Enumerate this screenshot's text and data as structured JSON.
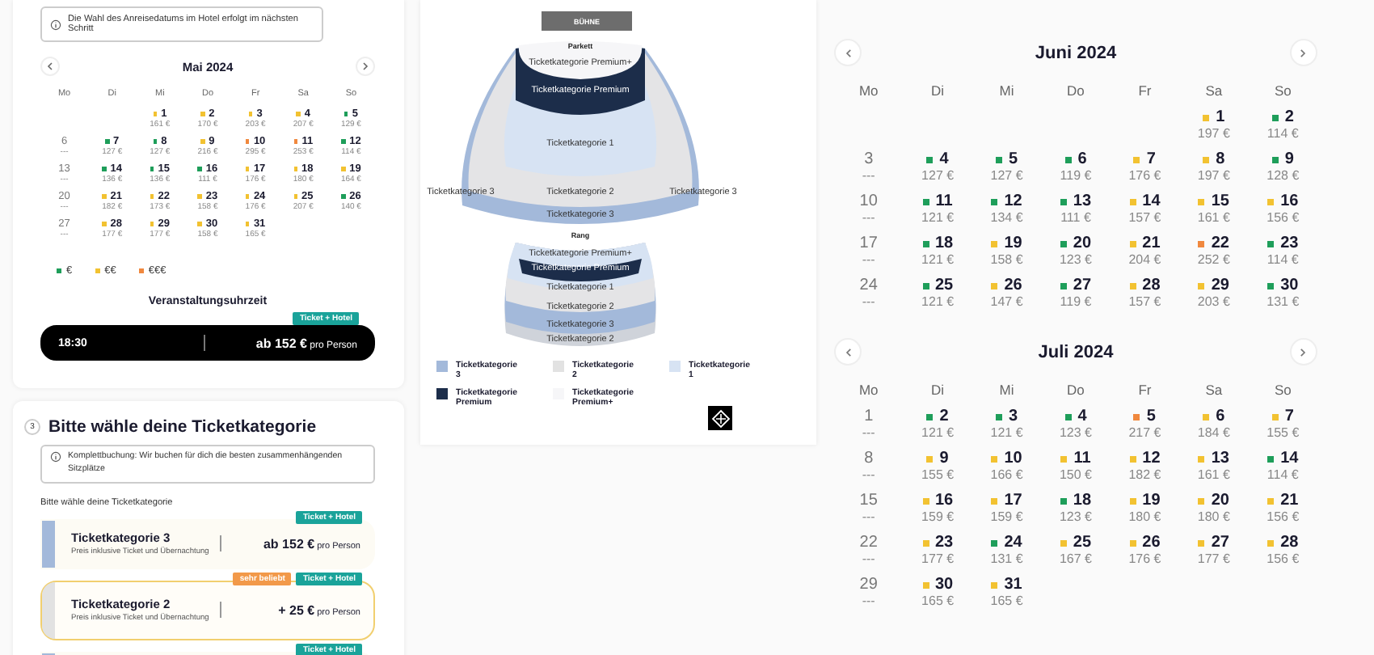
{
  "date_panel": {
    "notice": "Die Wahl des Anreisedatums im Hotel erfolgt im nächsten Schritt",
    "calendar": {
      "title": "Mai 2024",
      "weekdays": [
        "Mo",
        "Di",
        "Mi",
        "Do",
        "Fr",
        "Sa",
        "So"
      ],
      "weeks": [
        [
          {
            "day": "1",
            "price": "161 €",
            "color": "#f2c231"
          },
          {
            "day": "2",
            "price": "170 €",
            "color": "#f2c231"
          },
          {
            "day": "3",
            "price": "203 €",
            "color": "#f2c231"
          },
          {
            "day": "4",
            "price": "207 €",
            "color": "#f2c231"
          },
          {
            "day": "5",
            "price": "129 €",
            "color": "#1e9e5a"
          }
        ],
        [
          {
            "day": "6",
            "price": "---"
          },
          {
            "day": "7",
            "price": "127 €",
            "color": "#1e9e5a"
          },
          {
            "day": "8",
            "price": "127 €",
            "color": "#1e9e5a"
          },
          {
            "day": "9",
            "price": "216 €",
            "color": "#f2c231"
          },
          {
            "day": "10",
            "price": "295 €",
            "color": "#f0883e"
          },
          {
            "day": "11",
            "price": "253 €",
            "color": "#f0883e"
          },
          {
            "day": "12",
            "price": "114 €",
            "color": "#1e9e5a"
          }
        ],
        [
          {
            "day": "13",
            "price": "---"
          },
          {
            "day": "14",
            "price": "136 €",
            "color": "#1e9e5a"
          },
          {
            "day": "15",
            "price": "136 €",
            "color": "#1e9e5a"
          },
          {
            "day": "16",
            "price": "111 €",
            "color": "#1e9e5a"
          },
          {
            "day": "17",
            "price": "176 €",
            "color": "#f2c231"
          },
          {
            "day": "18",
            "price": "180 €",
            "color": "#f2c231"
          },
          {
            "day": "19",
            "price": "164 €",
            "color": "#f2c231"
          }
        ],
        [
          {
            "day": "20",
            "price": "---"
          },
          {
            "day": "21",
            "price": "182 €",
            "color": "#f2c231"
          },
          {
            "day": "22",
            "price": "173 €",
            "color": "#f2c231"
          },
          {
            "day": "23",
            "price": "158 €",
            "color": "#f2c231"
          },
          {
            "day": "24",
            "price": "176 €",
            "color": "#f2c231"
          },
          {
            "day": "25",
            "price": "207 €",
            "color": "#f2c231"
          },
          {
            "day": "26",
            "price": "140 €",
            "color": "#1e9e5a"
          }
        ],
        [
          {
            "day": "27",
            "price": "---"
          },
          {
            "day": "28",
            "price": "177 €",
            "color": "#f2c231"
          },
          {
            "day": "29",
            "price": "177 €",
            "color": "#f2c231"
          },
          {
            "day": "30",
            "price": "158 €",
            "color": "#f2c231"
          },
          {
            "day": "31",
            "price": "165 €",
            "color": "#f2c231"
          }
        ]
      ]
    },
    "legend": [
      {
        "label": "€",
        "color": "#1e9e5a"
      },
      {
        "label": "€€",
        "color": "#f2c231"
      },
      {
        "label": "€€€",
        "color": "#f0883e"
      }
    ],
    "time_heading": "Veranstaltungsuhrzeit",
    "time_slots": [
      {
        "time": "18:30",
        "price": "ab 152 €",
        "unit": "pro Person",
        "badge": "Ticket + Hotel",
        "selected": true
      }
    ]
  },
  "category_panel": {
    "step": "3",
    "heading": "Bitte wähle deine Ticketkategorie",
    "notice": "Komplettbuchung: Wir buchen für dich die besten zusammenhängenden Sitzplätze",
    "label": "Bitte wähle deine Ticketkategorie",
    "categories": [
      {
        "title": "Ticketkategorie 3",
        "description": "Preis inklusive Ticket und Übernachtung",
        "price": "ab 152 €",
        "unit": "pro Person",
        "badges": [
          {
            "kind": "hotel",
            "text": "Ticket + Hotel"
          }
        ],
        "color": "#a3b9da",
        "selected": false
      },
      {
        "title": "Ticketkategorie 2",
        "description": "Preis inklusive Ticket und Übernachtung",
        "price": "+ 25 €",
        "unit": "pro Person",
        "badges": [
          {
            "kind": "popular",
            "text": "sehr beliebt"
          },
          {
            "kind": "hotel",
            "text": "Ticket + Hotel"
          }
        ],
        "color": "#e2e2e2",
        "selected": true
      },
      {
        "badges": [
          {
            "kind": "hotel",
            "text": "Ticket + Hotel"
          }
        ],
        "color": "#a3b9da",
        "selected": false
      }
    ]
  },
  "seat_map": {
    "stage": "BÜHNE",
    "sections": [
      {
        "name": "Parkett",
        "zones": [
          "Ticketkategorie Premium+",
          "Ticketkategorie Premium",
          "Ticketkategorie 1",
          "Ticketkategorie 3",
          "Ticketkategorie 2",
          "Ticketkategorie 3",
          "Ticketkategorie 3"
        ]
      },
      {
        "name": "Rang",
        "zones": [
          "Ticketkategorie Premium+",
          "Ticketkategorie Premium",
          "Ticketkategorie 1",
          "Ticketkategorie 2",
          "Ticketkategorie 3",
          "Ticketkategorie 2"
        ]
      }
    ],
    "legend": [
      {
        "label": "Ticketkategorie 3",
        "color": "#a3b9da"
      },
      {
        "label": "Ticketkategorie 2",
        "color": "#e2e2e2"
      },
      {
        "label": "Ticketkategorie 1",
        "color": "#d7e3f3"
      },
      {
        "label": "Ticketkategorie Premium",
        "color": "#1c2d4a"
      },
      {
        "label": "Ticketkategorie Premium+",
        "color": "#f6f6f8"
      }
    ]
  },
  "calendars": [
    {
      "title": "Juni 2024",
      "weekdays": [
        "Mo",
        "Di",
        "Mi",
        "Do",
        "Fr",
        "Sa",
        "So"
      ],
      "weeks": [
        [
          {
            "day": "1",
            "price": "197 €",
            "color": "#f2c231"
          },
          {
            "day": "2",
            "price": "114 €",
            "color": "#1e9e5a"
          }
        ],
        [
          {
            "day": "3",
            "price": "---"
          },
          {
            "day": "4",
            "price": "127 €",
            "color": "#1e9e5a"
          },
          {
            "day": "5",
            "price": "127 €",
            "color": "#1e9e5a"
          },
          {
            "day": "6",
            "price": "119 €",
            "color": "#1e9e5a"
          },
          {
            "day": "7",
            "price": "176 €",
            "color": "#f2c231"
          },
          {
            "day": "8",
            "price": "197 €",
            "color": "#f2c231"
          },
          {
            "day": "9",
            "price": "128 €",
            "color": "#1e9e5a"
          }
        ],
        [
          {
            "day": "10",
            "price": "---"
          },
          {
            "day": "11",
            "price": "121 €",
            "color": "#1e9e5a"
          },
          {
            "day": "12",
            "price": "134 €",
            "color": "#1e9e5a"
          },
          {
            "day": "13",
            "price": "111 €",
            "color": "#1e9e5a"
          },
          {
            "day": "14",
            "price": "157 €",
            "color": "#f2c231"
          },
          {
            "day": "15",
            "price": "161 €",
            "color": "#f2c231"
          },
          {
            "day": "16",
            "price": "156 €",
            "color": "#f2c231"
          }
        ],
        [
          {
            "day": "17",
            "price": "---"
          },
          {
            "day": "18",
            "price": "121 €",
            "color": "#1e9e5a"
          },
          {
            "day": "19",
            "price": "158 €",
            "color": "#f2c231"
          },
          {
            "day": "20",
            "price": "123 €",
            "color": "#1e9e5a"
          },
          {
            "day": "21",
            "price": "204 €",
            "color": "#f2c231"
          },
          {
            "day": "22",
            "price": "252 €",
            "color": "#f0883e"
          },
          {
            "day": "23",
            "price": "114 €",
            "color": "#1e9e5a"
          }
        ],
        [
          {
            "day": "24",
            "price": "---"
          },
          {
            "day": "25",
            "price": "121 €",
            "color": "#1e9e5a"
          },
          {
            "day": "26",
            "price": "147 €",
            "color": "#f2c231"
          },
          {
            "day": "27",
            "price": "119 €",
            "color": "#1e9e5a"
          },
          {
            "day": "28",
            "price": "157 €",
            "color": "#f2c231"
          },
          {
            "day": "29",
            "price": "203 €",
            "color": "#f2c231"
          },
          {
            "day": "30",
            "price": "131 €",
            "color": "#1e9e5a"
          }
        ]
      ]
    },
    {
      "title": "Juli 2024",
      "weekdays": [
        "Mo",
        "Di",
        "Mi",
        "Do",
        "Fr",
        "Sa",
        "So"
      ],
      "weeks": [
        [
          {
            "day": "1",
            "price": "---"
          },
          {
            "day": "2",
            "price": "121 €",
            "color": "#1e9e5a"
          },
          {
            "day": "3",
            "price": "121 €",
            "color": "#1e9e5a"
          },
          {
            "day": "4",
            "price": "123 €",
            "color": "#1e9e5a"
          },
          {
            "day": "5",
            "price": "217 €",
            "color": "#f0883e"
          },
          {
            "day": "6",
            "price": "184 €",
            "color": "#f2c231"
          },
          {
            "day": "7",
            "price": "155 €",
            "color": "#f2c231"
          }
        ],
        [
          {
            "day": "8",
            "price": "---"
          },
          {
            "day": "9",
            "price": "155 €",
            "color": "#f2c231"
          },
          {
            "day": "10",
            "price": "166 €",
            "color": "#f2c231"
          },
          {
            "day": "11",
            "price": "150 €",
            "color": "#f2c231"
          },
          {
            "day": "12",
            "price": "182 €",
            "color": "#f2c231"
          },
          {
            "day": "13",
            "price": "161 €",
            "color": "#f2c231"
          },
          {
            "day": "14",
            "price": "114 €",
            "color": "#1e9e5a"
          }
        ],
        [
          {
            "day": "15",
            "price": "---"
          },
          {
            "day": "16",
            "price": "159 €",
            "color": "#f2c231"
          },
          {
            "day": "17",
            "price": "159 €",
            "color": "#f2c231"
          },
          {
            "day": "18",
            "price": "123 €",
            "color": "#1e9e5a"
          },
          {
            "day": "19",
            "price": "180 €",
            "color": "#f2c231"
          },
          {
            "day": "20",
            "price": "180 €",
            "color": "#f2c231"
          },
          {
            "day": "21",
            "price": "156 €",
            "color": "#f2c231"
          }
        ],
        [
          {
            "day": "22",
            "price": "---"
          },
          {
            "day": "23",
            "price": "177 €",
            "color": "#f2c231"
          },
          {
            "day": "24",
            "price": "131 €",
            "color": "#1e9e5a"
          },
          {
            "day": "25",
            "price": "167 €",
            "color": "#f2c231"
          },
          {
            "day": "26",
            "price": "176 €",
            "color": "#f2c231"
          },
          {
            "day": "27",
            "price": "177 €",
            "color": "#f2c231"
          },
          {
            "day": "28",
            "price": "156 €",
            "color": "#f2c231"
          }
        ],
        [
          {
            "day": "29",
            "price": "---"
          },
          {
            "day": "30",
            "price": "165 €",
            "color": "#f2c231"
          },
          {
            "day": "31",
            "price": "165 €",
            "color": "#f2c231"
          }
        ]
      ]
    }
  ]
}
